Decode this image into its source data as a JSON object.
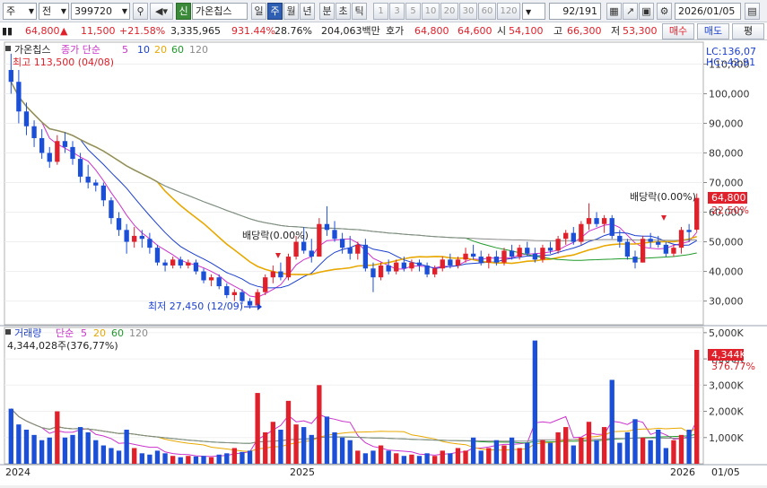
{
  "toolbar": {
    "market": "주",
    "type": "전",
    "code": "399720",
    "new_badge": "신",
    "stock_name": "가온칩스",
    "periods": [
      "일",
      "주",
      "월",
      "년",
      "분",
      "초",
      "틱"
    ],
    "active_period": "주",
    "intervals": [
      "1",
      "3",
      "5",
      "10",
      "20",
      "30",
      "60",
      "120"
    ],
    "count": "92",
    "total": "/191",
    "date": "2026/01/05"
  },
  "info": {
    "price": "64,800",
    "change_arrow": "▲",
    "change": "11,500",
    "change_pct": "+21.58%",
    "volume": "3,335,965",
    "vol_ratio": "931.44%",
    "turnover": "28.76%",
    "amount": "204,063백만",
    "quote_label": "호가",
    "ask": "64,800",
    "bid": "64,600",
    "open_label": "시",
    "open": "54,100",
    "high_label": "고",
    "high": "66,300",
    "low_label": "저",
    "low": "53,300",
    "buy_button": "매수",
    "sell_button": "매도",
    "eval_button": "평"
  },
  "price_panel": {
    "name_label": "가온칩스",
    "ma_label": "종가 단순",
    "ma_periods": [
      "5",
      "10",
      "20",
      "60",
      "120"
    ],
    "ma_colors": [
      "#cc33cc",
      "#1a3fd0",
      "#e8a800",
      "#1f9a2a",
      "#8a8a8a"
    ],
    "high_marker": "최고 113,500 (04/08)",
    "low_marker": "최저 27,450 (12/09)",
    "dividend_1": "배당락(0.00%)",
    "dividend_2": "배당락(0.00%)",
    "lc": "LC:136,07",
    "hc": "HC:-42.91",
    "price_tag": "64,800",
    "price_pct_tag": "22.50%"
  },
  "volume_panel": {
    "name_label": "거래량",
    "ma_label": "단순",
    "ma_periods": [
      "5",
      "20",
      "60",
      "120"
    ],
    "volume_text": "4,344,028주(376,77%)",
    "vol_tag": "4,344K",
    "vol_pct_tag": "376.77%"
  },
  "xaxis": {
    "labels": [
      "2024",
      "2025",
      "2026",
      "01/05"
    ]
  },
  "chart_data": {
    "type": "candlestick",
    "price_axis": {
      "ticks": [
        "110,000",
        "100,000",
        "90,000",
        "80,000",
        "70,000",
        "60,000",
        "50,000",
        "40,000",
        "30,000"
      ],
      "range": [
        22000,
        118000
      ]
    },
    "volume_axis": {
      "ticks": [
        "5,000K",
        "4,000K",
        "3,000K",
        "2,000K",
        "1,000K"
      ],
      "range": [
        0,
        5200000
      ]
    },
    "candles": [
      [
        108000,
        113500,
        100000,
        104000
      ],
      [
        104000,
        108000,
        90000,
        94000
      ],
      [
        94000,
        97000,
        86000,
        89000
      ],
      [
        89000,
        91000,
        82000,
        85000
      ],
      [
        85000,
        88000,
        78000,
        80000
      ],
      [
        80000,
        82000,
        75000,
        77000
      ],
      [
        77000,
        86000,
        76000,
        84000
      ],
      [
        84000,
        87000,
        80000,
        82000
      ],
      [
        82000,
        84000,
        76000,
        78000
      ],
      [
        78000,
        80000,
        70000,
        72000
      ],
      [
        72000,
        76000,
        68000,
        70000
      ],
      [
        70000,
        71000,
        67000,
        69000
      ],
      [
        69000,
        70000,
        62000,
        64000
      ],
      [
        64000,
        65000,
        56000,
        58000
      ],
      [
        58000,
        60000,
        52000,
        54000
      ],
      [
        54000,
        56000,
        46000,
        50000
      ],
      [
        50000,
        55000,
        48000,
        52000
      ],
      [
        52000,
        54000,
        48000,
        51000
      ],
      [
        51000,
        53000,
        46000,
        48000
      ],
      [
        48000,
        49000,
        42000,
        43000
      ],
      [
        43000,
        44000,
        40000,
        42000
      ],
      [
        42000,
        45000,
        41000,
        44000
      ],
      [
        44000,
        45000,
        41000,
        42000
      ],
      [
        42000,
        44000,
        41000,
        43000
      ],
      [
        43000,
        44000,
        39000,
        40000
      ],
      [
        40000,
        41000,
        36000,
        37000
      ],
      [
        37000,
        39000,
        35000,
        38000
      ],
      [
        38000,
        39000,
        34000,
        35000
      ],
      [
        35000,
        36000,
        31000,
        32000
      ],
      [
        32000,
        34000,
        30000,
        33000
      ],
      [
        33000,
        34000,
        29000,
        30000
      ],
      [
        30000,
        31000,
        27450,
        28500
      ],
      [
        28500,
        34000,
        28000,
        33000
      ],
      [
        33000,
        39000,
        32000,
        38000
      ],
      [
        38000,
        42000,
        36000,
        40000
      ],
      [
        40000,
        43000,
        37000,
        38000
      ],
      [
        38000,
        46000,
        37000,
        45000
      ],
      [
        45000,
        52000,
        44000,
        50000
      ],
      [
        50000,
        55000,
        46000,
        47000
      ],
      [
        47000,
        51000,
        43000,
        45000
      ],
      [
        45000,
        58000,
        45000,
        56000
      ],
      [
        56000,
        62000,
        52000,
        54000
      ],
      [
        54000,
        57000,
        50000,
        51000
      ],
      [
        51000,
        53000,
        46000,
        48000
      ],
      [
        48000,
        52000,
        44000,
        46000
      ],
      [
        46000,
        50000,
        44000,
        49000
      ],
      [
        49000,
        51000,
        40000,
        41000
      ],
      [
        41000,
        43000,
        33000,
        38000
      ],
      [
        38000,
        43000,
        37000,
        42000
      ],
      [
        42000,
        44000,
        39000,
        40000
      ],
      [
        40000,
        44000,
        39000,
        43000
      ],
      [
        43000,
        45000,
        40000,
        41000
      ],
      [
        41000,
        44000,
        40000,
        43000
      ],
      [
        43000,
        44000,
        40000,
        42000
      ],
      [
        42000,
        43000,
        38000,
        39000
      ],
      [
        39000,
        42000,
        38000,
        41000
      ],
      [
        41000,
        45000,
        40000,
        44000
      ],
      [
        44000,
        46000,
        41000,
        42000
      ],
      [
        42000,
        45000,
        41000,
        44000
      ],
      [
        44000,
        48000,
        43000,
        46000
      ],
      [
        46000,
        49000,
        44000,
        45000
      ],
      [
        45000,
        47000,
        42000,
        43000
      ],
      [
        43000,
        46000,
        41000,
        45000
      ],
      [
        45000,
        47000,
        42000,
        43000
      ],
      [
        43000,
        48000,
        42000,
        47000
      ],
      [
        47000,
        49000,
        44000,
        45000
      ],
      [
        45000,
        49000,
        44000,
        48000
      ],
      [
        48000,
        50000,
        45000,
        46000
      ],
      [
        46000,
        48000,
        43000,
        44000
      ],
      [
        44000,
        49000,
        43000,
        48000
      ],
      [
        48000,
        50000,
        46000,
        47000
      ],
      [
        47000,
        52000,
        46000,
        51000
      ],
      [
        51000,
        54000,
        49000,
        53000
      ],
      [
        53000,
        55000,
        49000,
        50000
      ],
      [
        50000,
        57000,
        49000,
        56000
      ],
      [
        56000,
        63000,
        54000,
        58000
      ],
      [
        58000,
        60000,
        55000,
        56000
      ],
      [
        56000,
        59000,
        53000,
        58000
      ],
      [
        58000,
        59000,
        51000,
        52000
      ],
      [
        52000,
        54000,
        48000,
        50000
      ],
      [
        50000,
        51000,
        44000,
        45000
      ],
      [
        45000,
        47000,
        41000,
        43000
      ],
      [
        43000,
        52000,
        43000,
        51000
      ],
      [
        51000,
        53000,
        48000,
        50000
      ],
      [
        50000,
        52000,
        48000,
        49000
      ],
      [
        49000,
        50000,
        45000,
        46000
      ],
      [
        46000,
        49000,
        45000,
        48000
      ],
      [
        48000,
        55000,
        46000,
        54000
      ],
      [
        54000,
        56000,
        50000,
        53300
      ],
      [
        54100,
        66300,
        53300,
        64800
      ]
    ],
    "volumes": [
      2100000,
      1500000,
      1300000,
      1100000,
      900000,
      1000000,
      2000000,
      1000000,
      1100000,
      1400000,
      1200000,
      900000,
      700000,
      600000,
      500000,
      1300000,
      600000,
      400000,
      350000,
      500000,
      400000,
      300000,
      250000,
      300000,
      280000,
      300000,
      250000,
      350000,
      400000,
      600000,
      450000,
      500000,
      2700000,
      1200000,
      1600000,
      1300000,
      2400000,
      1500000,
      1400000,
      1100000,
      3000000,
      1800000,
      1200000,
      1000000,
      900000,
      500000,
      400000,
      500000,
      700000,
      500000,
      400000,
      300000,
      350000,
      300000,
      400000,
      300000,
      500000,
      400000,
      600000,
      500000,
      1000000,
      500000,
      600000,
      900000,
      700000,
      1000000,
      600000,
      800000,
      4700000,
      900000,
      800000,
      1200000,
      1400000,
      700000,
      1000000,
      1600000,
      900000,
      1400000,
      3200000,
      800000,
      1200000,
      1700000,
      1000000,
      900000,
      1300000,
      600000,
      900000,
      1100000,
      1300000,
      4344028
    ]
  }
}
